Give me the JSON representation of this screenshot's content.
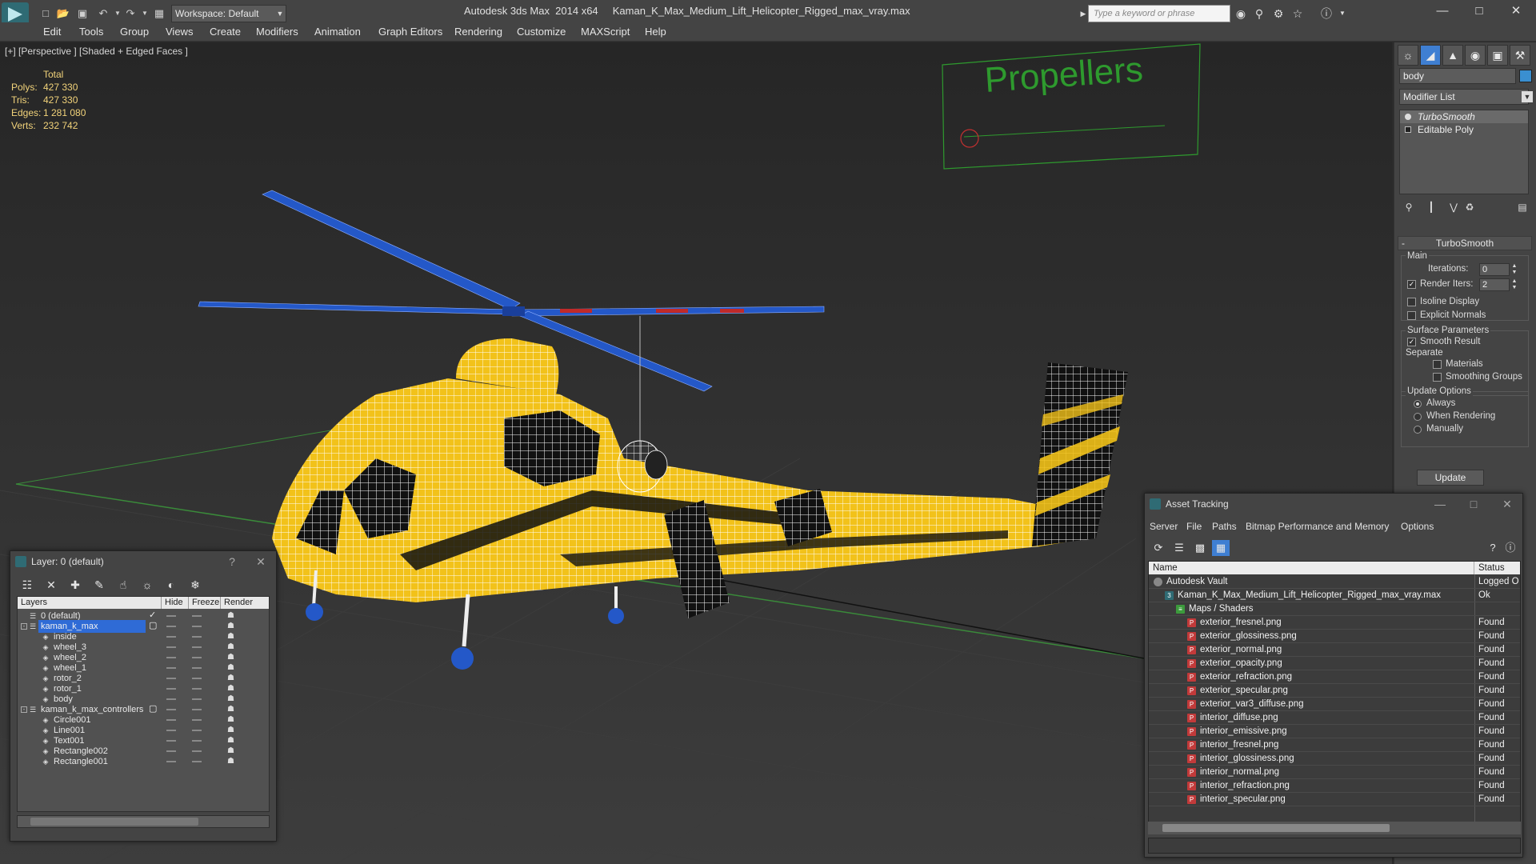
{
  "titlebar": {
    "workspace": "Workspace: Default",
    "app_name": "Autodesk 3ds Max  2014 x64",
    "file_name": "Kaman_K_Max_Medium_Lift_Helicopter_Rigged_max_vray.max",
    "search_placeholder": "Type a keyword or phrase"
  },
  "menu": [
    "Edit",
    "Tools",
    "Group",
    "Views",
    "Create",
    "Modifiers",
    "Animation",
    "Graph Editors",
    "Rendering",
    "Customize",
    "MAXScript",
    "Help"
  ],
  "viewport": {
    "label": "[+] [Perspective ] [Shaded + Edged Faces ]",
    "stats_header": "Total",
    "stats": [
      {
        "key": "Polys:",
        "value": "427 330"
      },
      {
        "key": "Tris:",
        "value": "427 330"
      },
      {
        "key": "Edges:",
        "value": "1 281 080"
      },
      {
        "key": "Verts:",
        "value": "232 742"
      }
    ],
    "scene_text": "Propellers"
  },
  "command_panel": {
    "object_name": "body",
    "object_color": "#3a8fd0",
    "modifier_list": "Modifier List",
    "stack": [
      "TurboSmooth",
      "Editable Poly"
    ],
    "rollout": "TurboSmooth",
    "main_label": "Main",
    "iterations_label": "Iterations:",
    "iterations_value": "0",
    "render_iters_label": "Render Iters:",
    "render_iters_value": "2",
    "isoline": "Isoline Display",
    "explicit_normals": "Explicit Normals",
    "surface_params": "Surface Parameters",
    "smooth_result": "Smooth Result",
    "separate": "Separate",
    "materials": "Materials",
    "smoothing_groups": "Smoothing Groups",
    "update_options": "Update Options",
    "always": "Always",
    "when_rendering": "When Rendering",
    "manually": "Manually",
    "update_button": "Update"
  },
  "layer_window": {
    "title": "Layer: 0 (default)",
    "columns": [
      "Layers",
      "Hide",
      "Freeze",
      "Render"
    ],
    "rows": [
      {
        "name": "0 (default)",
        "indent": 0,
        "type": "layer",
        "check": true
      },
      {
        "name": "kaman_k_max",
        "indent": 0,
        "type": "layer",
        "selected": true,
        "expand": true
      },
      {
        "name": "inside",
        "indent": 1,
        "type": "object"
      },
      {
        "name": "wheel_3",
        "indent": 1,
        "type": "object"
      },
      {
        "name": "wheel_2",
        "indent": 1,
        "type": "object"
      },
      {
        "name": "wheel_1",
        "indent": 1,
        "type": "object"
      },
      {
        "name": "rotor_2",
        "indent": 1,
        "type": "object"
      },
      {
        "name": "rotor_1",
        "indent": 1,
        "type": "object"
      },
      {
        "name": "body",
        "indent": 1,
        "type": "object"
      },
      {
        "name": "kaman_k_max_controllers",
        "indent": 0,
        "type": "layer",
        "expand": true
      },
      {
        "name": "Circle001",
        "indent": 1,
        "type": "object"
      },
      {
        "name": "Line001",
        "indent": 1,
        "type": "object"
      },
      {
        "name": "Text001",
        "indent": 1,
        "type": "object"
      },
      {
        "name": "Rectangle002",
        "indent": 1,
        "type": "object"
      },
      {
        "name": "Rectangle001",
        "indent": 1,
        "type": "object"
      }
    ]
  },
  "asset_window": {
    "title": "Asset Tracking",
    "menu": [
      "Server",
      "File",
      "Paths",
      "Bitmap Performance and Memory",
      "Options"
    ],
    "columns": [
      "Name",
      "Status"
    ],
    "rows": [
      {
        "name": "Autodesk Vault",
        "status": "Logged O",
        "indent": 0,
        "icon": "vault"
      },
      {
        "name": "Kaman_K_Max_Medium_Lift_Helicopter_Rigged_max_vray.max",
        "status": "Ok",
        "indent": 1,
        "icon": "max"
      },
      {
        "name": "Maps / Shaders",
        "status": "",
        "indent": 2,
        "icon": "maps"
      },
      {
        "name": "exterior_fresnel.png",
        "status": "Found",
        "indent": 3,
        "icon": "png"
      },
      {
        "name": "exterior_glossiness.png",
        "status": "Found",
        "indent": 3,
        "icon": "png"
      },
      {
        "name": "exterior_normal.png",
        "status": "Found",
        "indent": 3,
        "icon": "png"
      },
      {
        "name": "exterior_opacity.png",
        "status": "Found",
        "indent": 3,
        "icon": "png"
      },
      {
        "name": "exterior_refraction.png",
        "status": "Found",
        "indent": 3,
        "icon": "png"
      },
      {
        "name": "exterior_specular.png",
        "status": "Found",
        "indent": 3,
        "icon": "png"
      },
      {
        "name": "exterior_var3_diffuse.png",
        "status": "Found",
        "indent": 3,
        "icon": "png"
      },
      {
        "name": "interior_diffuse.png",
        "status": "Found",
        "indent": 3,
        "icon": "png"
      },
      {
        "name": "interior_emissive.png",
        "status": "Found",
        "indent": 3,
        "icon": "png"
      },
      {
        "name": "interior_fresnel.png",
        "status": "Found",
        "indent": 3,
        "icon": "png"
      },
      {
        "name": "interior_glossiness.png",
        "status": "Found",
        "indent": 3,
        "icon": "png"
      },
      {
        "name": "interior_normal.png",
        "status": "Found",
        "indent": 3,
        "icon": "png"
      },
      {
        "name": "interior_refraction.png",
        "status": "Found",
        "indent": 3,
        "icon": "png"
      },
      {
        "name": "interior_specular.png",
        "status": "Found",
        "indent": 3,
        "icon": "png"
      }
    ]
  },
  "colors": {
    "body_yellow": "#f2c21a",
    "wire": "#ffffff",
    "rotor_blue": "#2458c8",
    "helper_green": "#2e9a2e",
    "stats_yellow": "#f2d37a"
  }
}
